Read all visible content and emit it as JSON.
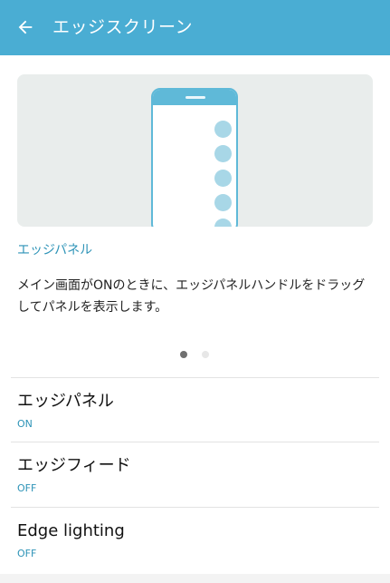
{
  "header": {
    "title": "エッジスクリーン",
    "back_icon": "arrow-left-icon",
    "background_color": "#4aadd3"
  },
  "preview": {
    "section_label": "エッジパネル",
    "description": "メイン画面がONのときに、エッジパネルハンドルをドラッグしてパネルを表示します。",
    "pager": {
      "page_count": 2,
      "current_page": 1
    }
  },
  "settings": [
    {
      "title": "エッジパネル",
      "value": "ON"
    },
    {
      "title": "エッジフィード",
      "value": "OFF"
    },
    {
      "title": "Edge lighting",
      "value": "OFF"
    }
  ],
  "colors": {
    "accent": "#2d93b7",
    "phone_outline": "#5fb9d8",
    "handle_bubble": "#a8d7e7"
  }
}
